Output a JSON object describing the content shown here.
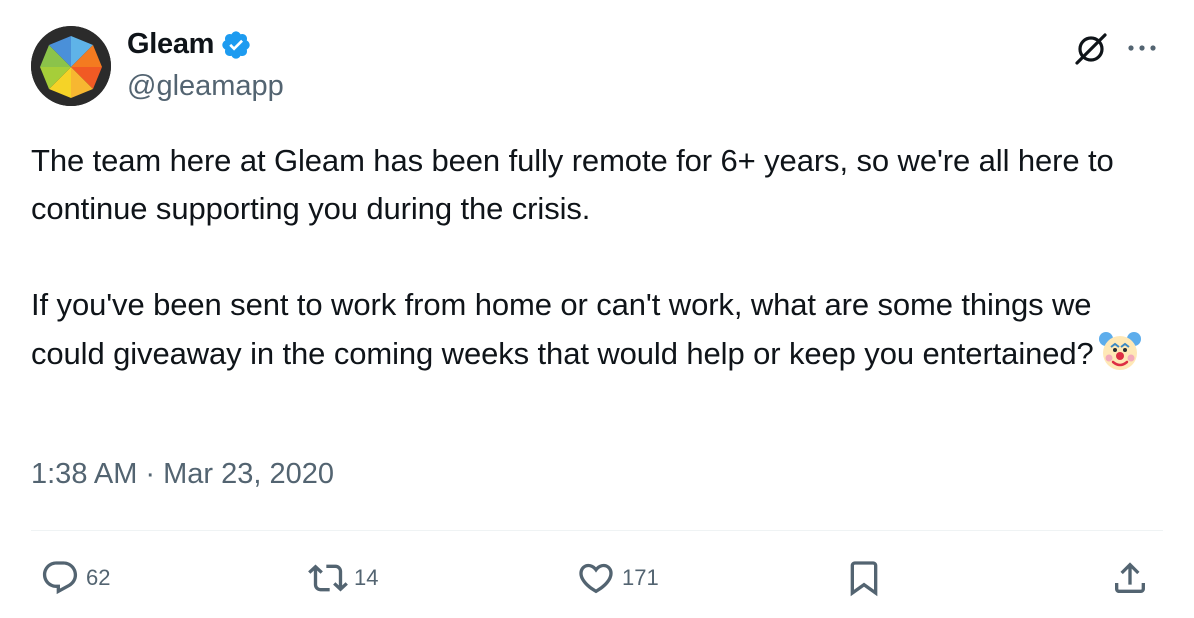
{
  "author": {
    "display_name": "Gleam",
    "handle": "@gleamapp",
    "verified": true
  },
  "tweet": {
    "paragraph_1": "The team here at Gleam has been fully remote for 6+ years, so we're all here to continue supporting you during the crisis.",
    "paragraph_2": "If you've been sent to work from home or can't work, what are some things we could giveaway in the coming weeks that would help or keep you entertained?",
    "emoji": "clown-face"
  },
  "meta": {
    "time": "1:38 AM",
    "separator": "·",
    "date": "Mar 23, 2020"
  },
  "actions": {
    "replies": "62",
    "retweets": "14",
    "likes": "171"
  },
  "colors": {
    "text": "#0f1419",
    "secondary": "#536471",
    "verified": "#1d9bf0",
    "divider": "#eff3f4"
  },
  "icons": [
    "verified-badge-icon",
    "grok-icon",
    "more-icon",
    "reply-icon",
    "retweet-icon",
    "like-icon",
    "bookmark-icon",
    "share-icon",
    "clown-emoji"
  ]
}
